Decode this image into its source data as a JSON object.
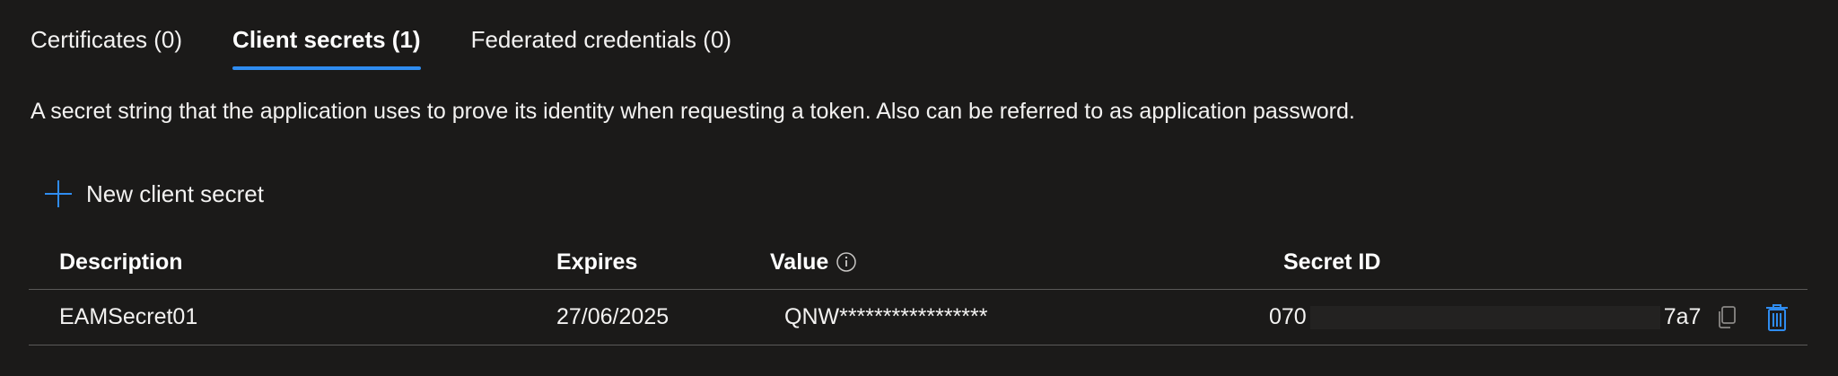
{
  "tabs": [
    {
      "label": "Certificates (0)",
      "active": false
    },
    {
      "label": "Client secrets (1)",
      "active": true
    },
    {
      "label": "Federated credentials (0)",
      "active": false
    }
  ],
  "description": "A secret string that the application uses to prove its identity when requesting a token. Also can be referred to as application password.",
  "new_secret_button": {
    "label": "New client secret",
    "icon": "plus-icon"
  },
  "table": {
    "headers": {
      "description": "Description",
      "expires": "Expires",
      "value": "Value",
      "secret_id": "Secret ID"
    },
    "rows": [
      {
        "description": "EAMSecret01",
        "expires": "27/06/2025",
        "value": "QNW*****************",
        "secret_id_prefix": "070",
        "secret_id_suffix": "7a7"
      }
    ]
  },
  "colors": {
    "background": "#1b1a19",
    "accent": "#2f8cf0",
    "text": "#f3f2f1",
    "divider": "#5a5958"
  }
}
